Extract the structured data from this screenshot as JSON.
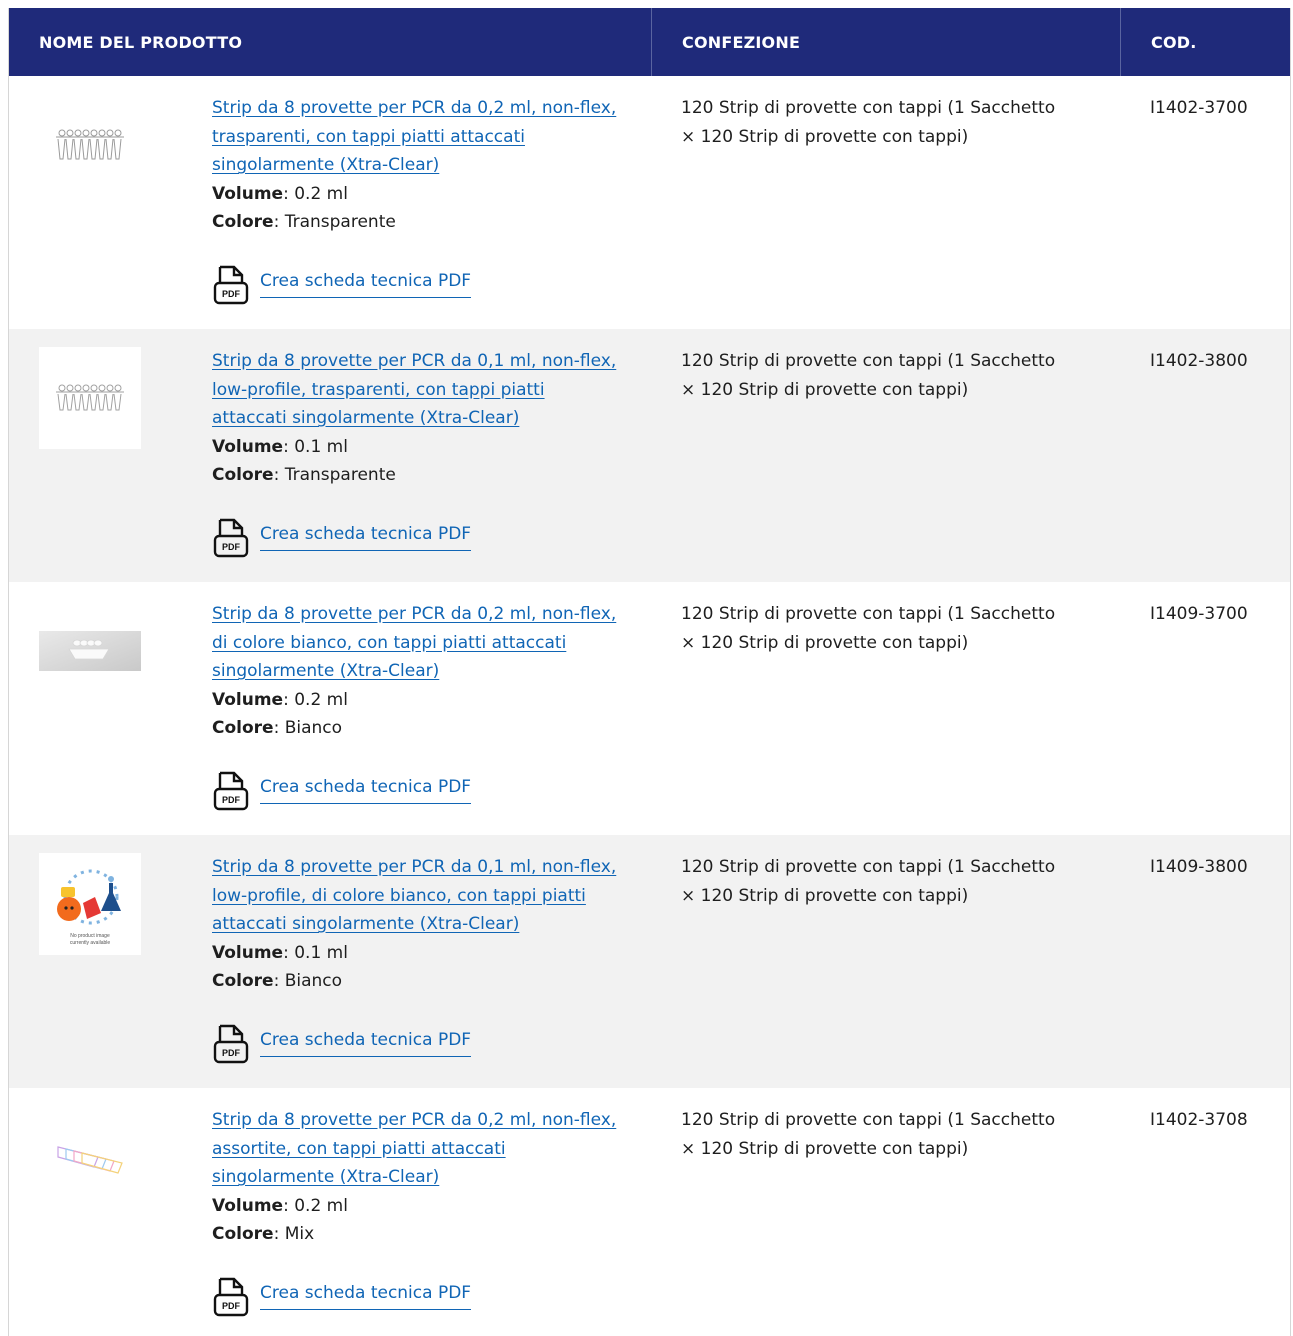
{
  "headers": {
    "product": "NOME DEL PRODOTTO",
    "package": "CONFEZIONE",
    "code": "COD."
  },
  "labels": {
    "volume": "Volume",
    "color": "Colore",
    "pdf_link": "Crea scheda tecnica PDF",
    "pdf_icon_text": "PDF",
    "no_image_line1": "No product image",
    "no_image_line2": "currently available"
  },
  "rows": [
    {
      "title": "Strip da 8 provette per PCR da 0,2 ml, non-flex, trasparenti, con tappi piatti attaccati singolarmente (Xtra-Clear)",
      "volume": ": 0.2 ml",
      "color": ": Transparente",
      "package": "120 Strip di provette con tappi (1 Sacchetto × 120 Strip di provette con tappi)",
      "code": "I1402-3700",
      "thumbnail": "clear-tube-strip"
    },
    {
      "title": "Strip da 8 provette per PCR da 0,1 ml, non-flex, low-profile, trasparenti, con tappi piatti attaccati singolarmente (Xtra-Clear)",
      "volume": ": 0.1 ml",
      "color": ": Transparente",
      "package": "120 Strip di provette con tappi (1 Sacchetto × 120 Strip di provette con tappi)",
      "code": "I1402-3800",
      "thumbnail": "clear-tube-strip-lowprofile"
    },
    {
      "title": "Strip da 8 provette per PCR da 0,2 ml, non-flex, di colore bianco, con tappi piatti attaccati singolarmente (Xtra-Clear)",
      "volume": ": 0.2 ml",
      "color": ": Bianco",
      "package": "120 Strip di provette con tappi (1 Sacchetto × 120 Strip di provette con tappi)",
      "code": "I1409-3700",
      "thumbnail": "white-tube-strip-photo"
    },
    {
      "title": "Strip da 8 provette per PCR da 0,1 ml, non-flex, low-profile, di colore bianco, con tappi piatti attaccati singolarmente (Xtra-Clear)",
      "volume": ": 0.1 ml",
      "color": ": Bianco",
      "package": "120 Strip di provette con tappi (1 Sacchetto × 120 Strip di provette con tappi)",
      "code": "I1409-3800",
      "thumbnail": "no-image-placeholder"
    },
    {
      "title": "Strip da 8 provette per PCR da 0,2 ml, non-flex, assortite, con tappi piatti attaccati singolarmente (Xtra-Clear)",
      "volume": ": 0.2 ml",
      "color": ": Mix",
      "package": "120 Strip di provette con tappi (1 Sacchetto × 120 Strip di provette con tappi)",
      "code": "I1402-3708",
      "thumbnail": "assorted-color-tube-strips"
    }
  ],
  "colors": {
    "header_bg": "#1f2a7a",
    "link": "#1065b5",
    "row_alt": "#f2f2f2"
  }
}
